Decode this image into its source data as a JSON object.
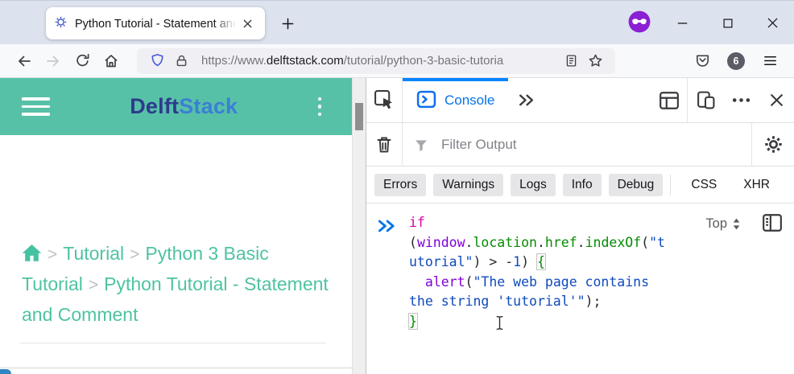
{
  "colors": {
    "teal_header": "#57c1a8",
    "breadcrumb_teal": "#4fc3a3",
    "active_tab_blue": "#0a84ff",
    "devtools_blue": "#0574e8",
    "private_purple": "#8a1fd4",
    "syntax": {
      "kw": "#dd00a9",
      "var": "#8000d7",
      "prop": "#058b00",
      "str": "#0f4abd",
      "num": "#0f4abd",
      "p": "#24292e",
      "brace": "#058b00"
    }
  },
  "titlebar": {
    "tab_title": "Python Tutorial - Statement and"
  },
  "navbar": {
    "url": {
      "scheme": "https://www.",
      "domain": "delftstack.com",
      "path": "/tutorial/python-3-basic-tutoria"
    },
    "extensions_badge": "6"
  },
  "page": {
    "brand": {
      "first": "Delft",
      "second": "Stack"
    },
    "breadcrumb": {
      "separator": ">",
      "items": [
        "Tutorial",
        "Python 3 Basic Tutorial",
        "Python Tutorial - Statement and Comment"
      ]
    }
  },
  "devtools": {
    "console_tab_label": "Console",
    "filter_placeholder": "Filter Output",
    "filter_buttons": [
      "Errors",
      "Warnings",
      "Logs",
      "Info",
      "Debug"
    ],
    "filter_links": [
      "CSS",
      "XHR"
    ],
    "context_selector": "Top",
    "code_lines": [
      [
        {
          "t": "if",
          "c": "kw"
        }
      ],
      [
        {
          "t": "(",
          "c": "p"
        },
        {
          "t": "window",
          "c": "var"
        },
        {
          "t": ".",
          "c": "p"
        },
        {
          "t": "location",
          "c": "prop"
        },
        {
          "t": ".",
          "c": "p"
        },
        {
          "t": "href",
          "c": "prop"
        },
        {
          "t": ".",
          "c": "p"
        },
        {
          "t": "indexOf",
          "c": "prop"
        },
        {
          "t": "(",
          "c": "p"
        },
        {
          "t": "\"t",
          "c": "str"
        }
      ],
      [
        {
          "t": "utorial\"",
          "c": "str"
        },
        {
          "t": ") > -",
          "c": "p"
        },
        {
          "t": "1",
          "c": "num"
        },
        {
          "t": ") ",
          "c": "p"
        },
        {
          "t": "{",
          "c": "brace"
        }
      ],
      [
        {
          "t": "  ",
          "c": "p"
        },
        {
          "t": "alert",
          "c": "var"
        },
        {
          "t": "(",
          "c": "p"
        },
        {
          "t": "\"The web page contains",
          "c": "str"
        }
      ],
      [
        {
          "t": "the string 'tutorial'\"",
          "c": "str"
        },
        {
          "t": ");",
          "c": "p"
        }
      ],
      [
        {
          "t": "}",
          "c": "brace"
        }
      ]
    ]
  }
}
